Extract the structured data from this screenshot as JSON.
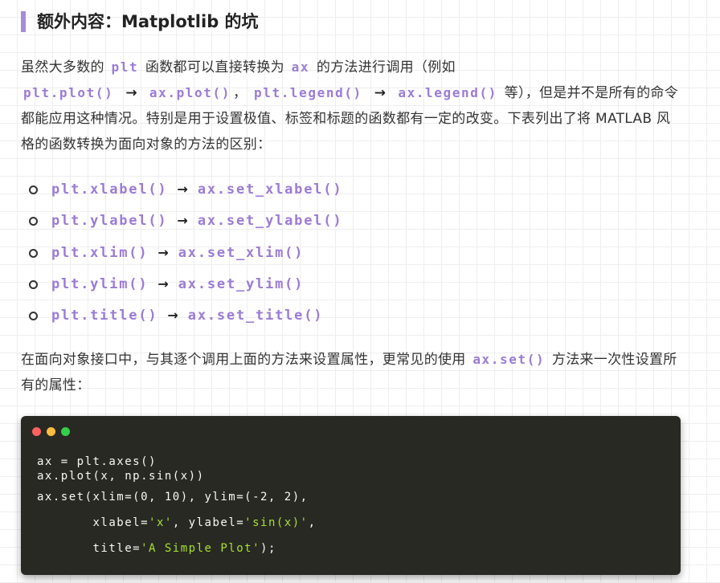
{
  "heading": "额外内容：Matplotlib 的坑",
  "para1": {
    "t1": "虽然大多数的 ",
    "c1": "plt",
    "t2": " 函数都可以直接转换为 ",
    "c2": "ax",
    "t3": " 的方法进行调用（例如 ",
    "c3": "plt.plot()",
    "arrow": "→",
    "c4": "ax.plot()",
    "t4": "， ",
    "c5": "plt.legend()",
    "c6": "ax.legend()",
    "t5": " 等），但是并不是所有的命令都能应用这种情况。特别是用于设置极值、标签和标题的函数都有一定的改变。下表列出了将 MATLAB 风格的函数转换为面向对象的方法的区别："
  },
  "bullets": [
    {
      "from": "plt.xlabel()",
      "to": "ax.set_xlabel()"
    },
    {
      "from": "plt.ylabel()",
      "to": "ax.set_ylabel()"
    },
    {
      "from": "plt.xlim()",
      "to": "ax.set_xlim()"
    },
    {
      "from": "plt.ylim()",
      "to": "ax.set_ylim()"
    },
    {
      "from": "plt.title()",
      "to": "ax.set_title()"
    }
  ],
  "arrow": "→",
  "para2": {
    "t1": "在面向对象接口中，与其逐个调用上面的方法来设置属性，更常见的使用 ",
    "c1": "ax.set()",
    "t2": " 方法来一次性设置所有的属性："
  },
  "code": {
    "line1": "ax = plt.axes()",
    "line2": "ax.plot(x, np.sin(x))",
    "line3": "ax.set(xlim=(0, 10), ylim=(-2, 2),",
    "line4_pre": "       xlabel=",
    "line4_s1": "'x'",
    "line4_mid": ", ylabel=",
    "line4_s2": "'sin(x)'",
    "line4_post": ",",
    "line5_pre": "       title=",
    "line5_s1": "'A Simple Plot'",
    "line5_post": ");"
  },
  "colors": {
    "accent": "#a78bdb",
    "inline_code": "#9b7bd6",
    "code_bg": "#282923",
    "code_string": "#a6e22e"
  }
}
